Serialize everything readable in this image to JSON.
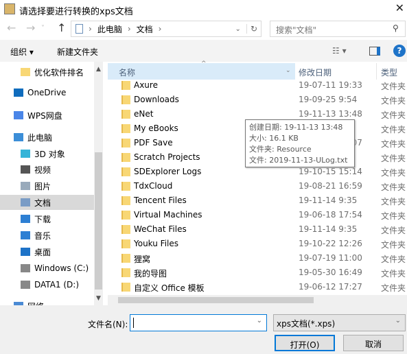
{
  "window": {
    "title": "请选择要进行转换的xps文档",
    "close_icon": "✕"
  },
  "nav": {
    "back": "←",
    "forward": "→",
    "recent": "˅",
    "up": "↑",
    "breadcrumb": [
      "此电脑",
      "文档"
    ],
    "refresh": "↻",
    "search_placeholder": "搜索\"文档\""
  },
  "toolbar": {
    "organize": "组织 ▾",
    "new_folder": "新建文件夹",
    "help": "?"
  },
  "sidebar": {
    "items": [
      {
        "label": "优化软件排名",
        "icon": "folder-icon",
        "indent": 2,
        "selected": false
      },
      {
        "label": "OneDrive",
        "icon": "cloud-icon",
        "indent": 1,
        "selected": false
      },
      {
        "label": "WPS网盘",
        "icon": "wps-cloud-icon",
        "indent": 1,
        "selected": false
      },
      {
        "label": "此电脑",
        "icon": "computer-icon",
        "indent": 1,
        "selected": false
      },
      {
        "label": "3D 对象",
        "icon": "cube-icon",
        "indent": 2,
        "selected": false
      },
      {
        "label": "视频",
        "icon": "video-icon",
        "indent": 2,
        "selected": false
      },
      {
        "label": "图片",
        "icon": "picture-icon",
        "indent": 2,
        "selected": false
      },
      {
        "label": "文档",
        "icon": "document-icon",
        "indent": 2,
        "selected": true
      },
      {
        "label": "下载",
        "icon": "download-icon",
        "indent": 2,
        "selected": false
      },
      {
        "label": "音乐",
        "icon": "music-icon",
        "indent": 2,
        "selected": false
      },
      {
        "label": "桌面",
        "icon": "desktop-icon",
        "indent": 2,
        "selected": false
      },
      {
        "label": "Windows (C:)",
        "icon": "drive-c-icon",
        "indent": 2,
        "selected": false
      },
      {
        "label": "DATA1 (D:)",
        "icon": "drive-icon",
        "indent": 2,
        "selected": false
      },
      {
        "label": "网络",
        "icon": "network-icon",
        "indent": 1,
        "selected": false
      }
    ]
  },
  "columns": {
    "name": "名称",
    "date": "修改日期",
    "type": "类型"
  },
  "files": [
    {
      "name": "Axure",
      "date": "19-07-11 19:33",
      "type": "文件夹"
    },
    {
      "name": "Downloads",
      "date": "19-09-25 9:54",
      "type": "文件夹"
    },
    {
      "name": "eNet",
      "date": "19-11-13 13:48",
      "type": "文件夹"
    },
    {
      "name": "My eBooks",
      "date": "",
      "type": "文件夹"
    },
    {
      "name": "PDF Save",
      "date": "19-09-23 10:07",
      "type": "文件夹"
    },
    {
      "name": "Scratch Projects",
      "date": "",
      "type": "文件夹"
    },
    {
      "name": "SDExplorer Logs",
      "date": "19-10-15 15:14",
      "type": "文件夹"
    },
    {
      "name": "TdxCloud",
      "date": "19-08-21 16:59",
      "type": "文件夹"
    },
    {
      "name": "Tencent Files",
      "date": "19-11-14 9:35",
      "type": "文件夹"
    },
    {
      "name": "Virtual Machines",
      "date": "19-06-18 17:54",
      "type": "文件夹"
    },
    {
      "name": "WeChat Files",
      "date": "19-11-14 9:35",
      "type": "文件夹"
    },
    {
      "name": "Youku Files",
      "date": "19-10-22 12:26",
      "type": "文件夹"
    },
    {
      "name": "狸窝",
      "date": "19-07-19 11:00",
      "type": "文件夹"
    },
    {
      "name": "我的导图",
      "date": "19-05-30 16:49",
      "type": "文件夹"
    },
    {
      "name": "自定义 Office 模板",
      "date": "19-06-12 17:27",
      "type": "文件夹"
    }
  ],
  "tooltip": [
    "创建日期: 19-11-13 13:48",
    "大小: 16.1 KB",
    "文件夹: Resource",
    "文件: 2019-11-13-ULog.txt"
  ],
  "footer": {
    "filename_label": "文件名(N):",
    "filename_value": "",
    "filter": "xps文档(*.xps)",
    "open": "打开(O)",
    "cancel": "取消"
  },
  "colors": {
    "accent": "#0078d7",
    "header_hover": "#d9ebf9",
    "selected": "#d9d9d9",
    "folder": "#f8d775"
  }
}
